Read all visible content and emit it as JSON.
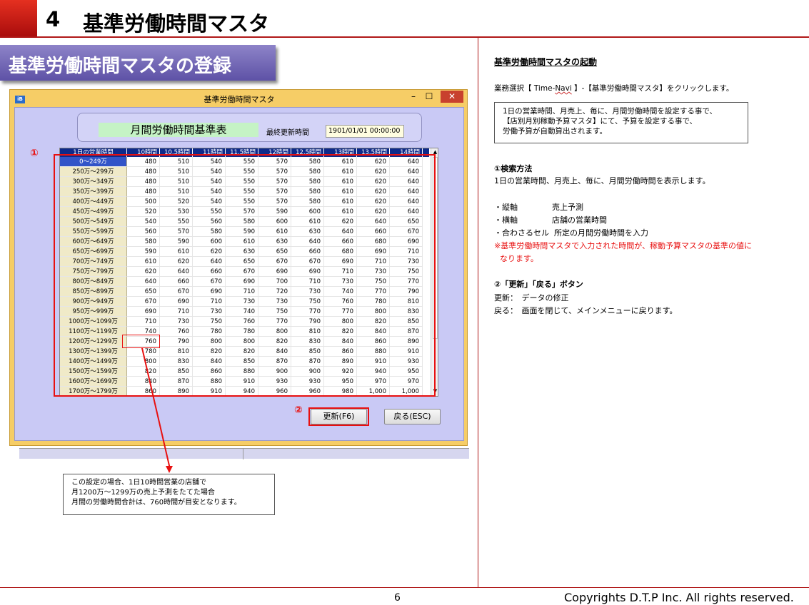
{
  "header": {
    "section_number": "4",
    "title": "基準労働時間マスタ"
  },
  "banner": "基準労働時間マスタの登録",
  "window": {
    "title": "基準労働時間マスタ",
    "logo": "iB",
    "min_symbol": "–",
    "max_symbol": "☐",
    "close_symbol": "✕",
    "sheet_title": "月間労働時間基準表",
    "last_updated_label": "最終更新時間",
    "last_updated_value": "1901/01/01 00:00:00",
    "buttons": {
      "update": "更新(F6)",
      "back": "戻る(ESC)"
    },
    "grid": {
      "headers": [
        "1日の営業時間",
        "10時間",
        "10.5時間",
        "11時間",
        "11.5時間",
        "12時間",
        "12.5時間",
        "13時間",
        "13.5時間",
        "14時間"
      ],
      "rows": [
        [
          "0～249万",
          "480",
          "510",
          "540",
          "550",
          "570",
          "580",
          "610",
          "620",
          "640"
        ],
        [
          "250万～299万",
          "480",
          "510",
          "540",
          "550",
          "570",
          "580",
          "610",
          "620",
          "640"
        ],
        [
          "300万～349万",
          "480",
          "510",
          "540",
          "550",
          "570",
          "580",
          "610",
          "620",
          "640"
        ],
        [
          "350万～399万",
          "480",
          "510",
          "540",
          "550",
          "570",
          "580",
          "610",
          "620",
          "640"
        ],
        [
          "400万～449万",
          "500",
          "520",
          "540",
          "550",
          "570",
          "580",
          "610",
          "620",
          "640"
        ],
        [
          "450万～499万",
          "520",
          "530",
          "550",
          "570",
          "590",
          "600",
          "610",
          "620",
          "640"
        ],
        [
          "500万～549万",
          "540",
          "550",
          "560",
          "580",
          "600",
          "610",
          "620",
          "640",
          "650"
        ],
        [
          "550万～599万",
          "560",
          "570",
          "580",
          "590",
          "610",
          "630",
          "640",
          "660",
          "670"
        ],
        [
          "600万～649万",
          "580",
          "590",
          "600",
          "610",
          "630",
          "640",
          "660",
          "680",
          "690"
        ],
        [
          "650万～699万",
          "590",
          "610",
          "620",
          "630",
          "650",
          "660",
          "680",
          "690",
          "710"
        ],
        [
          "700万～749万",
          "610",
          "620",
          "640",
          "650",
          "670",
          "670",
          "690",
          "710",
          "730"
        ],
        [
          "750万～799万",
          "620",
          "640",
          "660",
          "670",
          "690",
          "690",
          "710",
          "730",
          "750"
        ],
        [
          "800万～849万",
          "640",
          "660",
          "670",
          "690",
          "700",
          "710",
          "730",
          "750",
          "770"
        ],
        [
          "850万～899万",
          "650",
          "670",
          "690",
          "710",
          "720",
          "730",
          "740",
          "770",
          "790"
        ],
        [
          "900万～949万",
          "670",
          "690",
          "710",
          "730",
          "730",
          "750",
          "760",
          "780",
          "810"
        ],
        [
          "950万～999万",
          "690",
          "710",
          "730",
          "740",
          "750",
          "770",
          "770",
          "800",
          "830"
        ],
        [
          "1000万～1099万",
          "710",
          "730",
          "750",
          "760",
          "770",
          "790",
          "800",
          "820",
          "850"
        ],
        [
          "1100万～1199万",
          "740",
          "760",
          "780",
          "780",
          "800",
          "810",
          "820",
          "840",
          "870"
        ],
        [
          "1200万～1299万",
          "760",
          "790",
          "800",
          "800",
          "820",
          "830",
          "840",
          "860",
          "890"
        ],
        [
          "1300万～1399万",
          "780",
          "810",
          "820",
          "820",
          "840",
          "850",
          "860",
          "880",
          "910"
        ],
        [
          "1400万～1499万",
          "800",
          "830",
          "840",
          "850",
          "870",
          "870",
          "890",
          "910",
          "930"
        ],
        [
          "1500万～1599万",
          "820",
          "850",
          "860",
          "880",
          "900",
          "900",
          "920",
          "940",
          "950"
        ],
        [
          "1600万～1699万",
          "840",
          "870",
          "880",
          "910",
          "930",
          "930",
          "950",
          "970",
          "970"
        ],
        [
          "1700万～1799万",
          "860",
          "890",
          "910",
          "940",
          "960",
          "960",
          "980",
          "1,000",
          "1,000"
        ]
      ]
    }
  },
  "markers": {
    "one": "①",
    "two": "②"
  },
  "callout": [
    "この設定の場合、1日10時間営業の店舗で",
    "月1200万～1299万の売上予測をたてた場合",
    "月間の労働時間合計は、760時間が目安となります。"
  ],
  "right": {
    "heading": "基準労働時間マスタの起動",
    "instruction_a": "業務選択【 Time-",
    "instruction_navi": "Navi",
    "instruction_b": " 】-【基準労働時間マスタ】をクリックします。",
    "info_lines": [
      "1日の営業時間、月売上、毎に、月間労働時間を設定する事で、",
      "【店別月別稼動予算マスタ】にて、予算を設定する事で、",
      "労働予算が自動算出されます。"
    ],
    "search_heading": "①検索方法",
    "search_desc": "1日の営業時間、月売上、毎に、月間労働時間を表示します。",
    "axes": [
      {
        "label": "・縦軸",
        "value": "売上予測"
      },
      {
        "label": "・横軸",
        "value": "店舗の営業時間"
      },
      {
        "label": "・合わさるセル",
        "value": "所定の月間労働時間を入力"
      }
    ],
    "note_line1": "※基準労働時間マスタで入力された時間が、稼動予算マスタの基準の値に",
    "note_line2": "なります。",
    "buttons_heading": "②「更新」「戻る」ボタン",
    "update_desc": "更新：　データの修正",
    "back_desc": "戻る：　画面を閉じて、メインメニューに戻ります。"
  },
  "footer": {
    "page": "6",
    "copyright": "Copyrights  D.T.P Inc. All rights reserved."
  }
}
